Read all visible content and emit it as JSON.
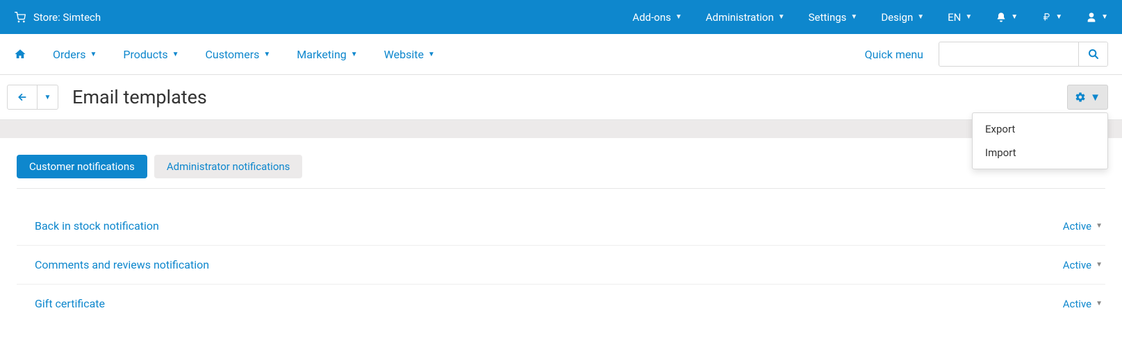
{
  "topbar": {
    "store_label": "Store: Simtech",
    "menu": {
      "addons": "Add-ons",
      "administration": "Administration",
      "settings": "Settings",
      "design": "Design",
      "language": "EN"
    }
  },
  "nav": {
    "orders": "Orders",
    "products": "Products",
    "customers": "Customers",
    "marketing": "Marketing",
    "website": "Website",
    "quick_menu": "Quick menu",
    "search_placeholder": ""
  },
  "page": {
    "title": "Email templates",
    "gear_menu": {
      "export": "Export",
      "import": "Import"
    }
  },
  "tabs": {
    "customer": "Customer notifications",
    "admin": "Administrator notifications"
  },
  "rows": [
    {
      "title": "Back in stock notification",
      "status": "Active"
    },
    {
      "title": "Comments and reviews notification",
      "status": "Active"
    },
    {
      "title": "Gift certificate",
      "status": "Active"
    }
  ]
}
